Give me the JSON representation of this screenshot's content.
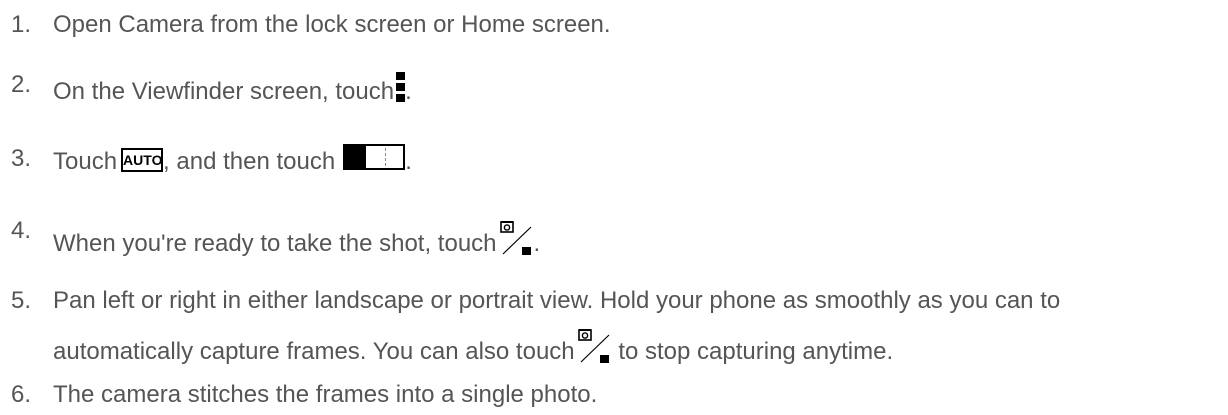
{
  "steps": [
    {
      "number": "1.",
      "text": "Open Camera from the lock screen or Home screen."
    },
    {
      "number": "2.",
      "text_before": "On the Viewfinder screen, touch",
      "icon": "menu-vertical-icon",
      "text_after": "."
    },
    {
      "number": "3.",
      "text_before": "Touch",
      "icon1": "auto-mode-icon",
      "icon1_label": "AUTO",
      "text_middle": ", and then touch",
      "icon2": "panorama-mode-icon",
      "text_after": "."
    },
    {
      "number": "4.",
      "text_before": "When you're ready to take the shot, touch",
      "icon": "capture-stop-icon",
      "text_after": "."
    },
    {
      "number": "5.",
      "line1": "Pan left or right in either landscape or portrait view. Hold your phone as smoothly as you can to",
      "line2_before": "automatically capture frames. You can also touch",
      "icon": "capture-stop-icon",
      "line2_after": "to stop capturing anytime."
    },
    {
      "number": "6.",
      "text": "The camera stitches the frames into a single photo."
    }
  ],
  "colors": {
    "text": "#555555",
    "icon": "#000000"
  }
}
